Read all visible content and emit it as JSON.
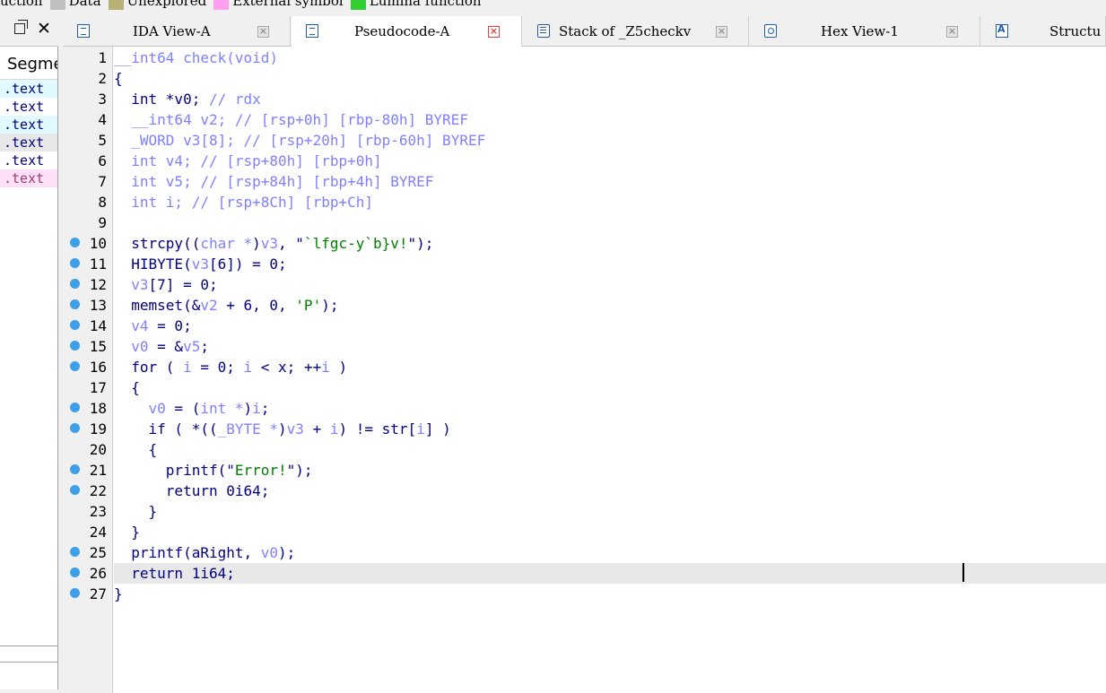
{
  "legend": {
    "items": [
      {
        "label": "uction",
        "color": ""
      },
      {
        "label": "Data",
        "color": "#c0c0c0"
      },
      {
        "label": "Unexplored",
        "color": "#b8b074"
      },
      {
        "label": "External symbol",
        "color": "#ff9fef"
      },
      {
        "label": "Lumina function",
        "color": "#30d030"
      }
    ]
  },
  "left_panel": {
    "close_glyph": "✕",
    "header": "Segme",
    "rows": [
      {
        "label": ".text",
        "bg": "#e0faff",
        "color": "#000080"
      },
      {
        "label": ".text",
        "bg": "#ffffff",
        "color": "#000080"
      },
      {
        "label": ".text",
        "bg": "#e0faff",
        "color": "#000080"
      },
      {
        "label": ".text",
        "bg": "#e8e8e8",
        "color": "#000080"
      },
      {
        "label": ".text",
        "bg": "#ffffff",
        "color": "#000080"
      },
      {
        "label": ".text",
        "bg": "#ffe0f8",
        "color": "#a04070"
      }
    ]
  },
  "tabs": [
    {
      "label": "IDA View-A",
      "icon": "doc-icon",
      "active": false,
      "close_glyph": "×"
    },
    {
      "label": "Pseudocode-A",
      "icon": "doc-icon",
      "active": true,
      "close_glyph": "×"
    },
    {
      "label": "Stack of _Z5checkv",
      "icon": "stack-icon",
      "active": false,
      "close_glyph": "×"
    },
    {
      "label": "Hex View-1",
      "icon": "hex-icon",
      "active": false,
      "close_glyph": "×"
    },
    {
      "label": "Structu",
      "icon": "struct-icon",
      "active": false,
      "close_glyph": ""
    }
  ],
  "colors": {
    "breakpoint": "#3fa0e8",
    "keyword": "#000080",
    "variable": "#8080ff",
    "string": "#008000",
    "comment": "#8080ff"
  },
  "code": {
    "current_line": 26,
    "lines": [
      {
        "n": "1",
        "bp": false,
        "tokens": [
          {
            "t": "__int64 check(void)",
            "c": "g"
          }
        ]
      },
      {
        "n": "2",
        "bp": false,
        "tokens": [
          {
            "t": "{",
            "c": "k"
          }
        ]
      },
      {
        "n": "3",
        "bp": false,
        "tokens": [
          {
            "t": "  int *v0; ",
            "c": "k"
          },
          {
            "t": "// rdx",
            "c": "c"
          }
        ]
      },
      {
        "n": "4",
        "bp": false,
        "tokens": [
          {
            "t": "  __int64 v2; ",
            "c": "g"
          },
          {
            "t": "// [rsp+0h] [rbp-80h] BYREF",
            "c": "c"
          }
        ]
      },
      {
        "n": "5",
        "bp": false,
        "tokens": [
          {
            "t": "  _WORD v3[8]; ",
            "c": "g"
          },
          {
            "t": "// [rsp+20h] [rbp-60h] BYREF",
            "c": "c"
          }
        ]
      },
      {
        "n": "6",
        "bp": false,
        "tokens": [
          {
            "t": "  int v4; ",
            "c": "g"
          },
          {
            "t": "// [rsp+80h] [rbp+0h]",
            "c": "c"
          }
        ]
      },
      {
        "n": "7",
        "bp": false,
        "tokens": [
          {
            "t": "  int v5; ",
            "c": "g"
          },
          {
            "t": "// [rsp+84h] [rbp+4h] BYREF",
            "c": "c"
          }
        ]
      },
      {
        "n": "8",
        "bp": false,
        "tokens": [
          {
            "t": "  int i; ",
            "c": "g"
          },
          {
            "t": "// [rsp+8Ch] [rbp+Ch]",
            "c": "c"
          }
        ]
      },
      {
        "n": "9",
        "bp": false,
        "tokens": []
      },
      {
        "n": "10",
        "bp": true,
        "tokens": [
          {
            "t": "  strcpy((",
            "c": "k"
          },
          {
            "t": "char *",
            "c": "g"
          },
          {
            "t": ")",
            "c": "k"
          },
          {
            "t": "v3",
            "c": "g"
          },
          {
            "t": ", \"",
            "c": "k"
          },
          {
            "t": "`lfgc-y`b}v!",
            "c": "s"
          },
          {
            "t": "\");",
            "c": "k"
          }
        ]
      },
      {
        "n": "11",
        "bp": true,
        "tokens": [
          {
            "t": "  HIBYTE(",
            "c": "k"
          },
          {
            "t": "v3",
            "c": "g"
          },
          {
            "t": "[6]) = 0;",
            "c": "k"
          }
        ]
      },
      {
        "n": "12",
        "bp": true,
        "tokens": [
          {
            "t": "  ",
            "c": "k"
          },
          {
            "t": "v3",
            "c": "g"
          },
          {
            "t": "[7] = 0;",
            "c": "k"
          }
        ]
      },
      {
        "n": "13",
        "bp": true,
        "tokens": [
          {
            "t": "  memset(&",
            "c": "k"
          },
          {
            "t": "v2",
            "c": "g"
          },
          {
            "t": " + 6, 0, ",
            "c": "k"
          },
          {
            "t": "'P'",
            "c": "s"
          },
          {
            "t": ");",
            "c": "k"
          }
        ]
      },
      {
        "n": "14",
        "bp": true,
        "tokens": [
          {
            "t": "  ",
            "c": "k"
          },
          {
            "t": "v4",
            "c": "g"
          },
          {
            "t": " = 0;",
            "c": "k"
          }
        ]
      },
      {
        "n": "15",
        "bp": true,
        "tokens": [
          {
            "t": "  ",
            "c": "k"
          },
          {
            "t": "v0",
            "c": "g"
          },
          {
            "t": " = &",
            "c": "k"
          },
          {
            "t": "v5",
            "c": "g"
          },
          {
            "t": ";",
            "c": "k"
          }
        ]
      },
      {
        "n": "16",
        "bp": true,
        "tokens": [
          {
            "t": "  for ( ",
            "c": "k"
          },
          {
            "t": "i",
            "c": "g"
          },
          {
            "t": " = 0; ",
            "c": "k"
          },
          {
            "t": "i",
            "c": "g"
          },
          {
            "t": " < x; ++",
            "c": "k"
          },
          {
            "t": "i",
            "c": "g"
          },
          {
            "t": " )",
            "c": "k"
          }
        ]
      },
      {
        "n": "17",
        "bp": false,
        "tokens": [
          {
            "t": "  {",
            "c": "k"
          }
        ]
      },
      {
        "n": "18",
        "bp": true,
        "tokens": [
          {
            "t": "    ",
            "c": "k"
          },
          {
            "t": "v0",
            "c": "g"
          },
          {
            "t": " = (",
            "c": "k"
          },
          {
            "t": "int *",
            "c": "g"
          },
          {
            "t": ")",
            "c": "k"
          },
          {
            "t": "i",
            "c": "g"
          },
          {
            "t": ";",
            "c": "k"
          }
        ]
      },
      {
        "n": "19",
        "bp": true,
        "tokens": [
          {
            "t": "    if ( *((",
            "c": "k"
          },
          {
            "t": "_BYTE *",
            "c": "g"
          },
          {
            "t": ")",
            "c": "k"
          },
          {
            "t": "v3",
            "c": "g"
          },
          {
            "t": " + ",
            "c": "k"
          },
          {
            "t": "i",
            "c": "g"
          },
          {
            "t": ") != str[",
            "c": "k"
          },
          {
            "t": "i",
            "c": "g"
          },
          {
            "t": "] )",
            "c": "k"
          }
        ]
      },
      {
        "n": "20",
        "bp": false,
        "tokens": [
          {
            "t": "    {",
            "c": "k"
          }
        ]
      },
      {
        "n": "21",
        "bp": true,
        "tokens": [
          {
            "t": "      printf(\"",
            "c": "k"
          },
          {
            "t": "Error!",
            "c": "s"
          },
          {
            "t": "\");",
            "c": "k"
          }
        ]
      },
      {
        "n": "22",
        "bp": true,
        "tokens": [
          {
            "t": "      return 0i64;",
            "c": "k"
          }
        ]
      },
      {
        "n": "23",
        "bp": false,
        "tokens": [
          {
            "t": "    }",
            "c": "k"
          }
        ]
      },
      {
        "n": "24",
        "bp": false,
        "tokens": [
          {
            "t": "  }",
            "c": "k"
          }
        ]
      },
      {
        "n": "25",
        "bp": true,
        "tokens": [
          {
            "t": "  printf(aRight, ",
            "c": "k"
          },
          {
            "t": "v0",
            "c": "g"
          },
          {
            "t": ");",
            "c": "k"
          }
        ]
      },
      {
        "n": "26",
        "bp": true,
        "tokens": [
          {
            "t": "  return 1i64;",
            "c": "k"
          }
        ]
      },
      {
        "n": "27",
        "bp": true,
        "tokens": [
          {
            "t": "}",
            "c": "k"
          }
        ]
      }
    ]
  }
}
